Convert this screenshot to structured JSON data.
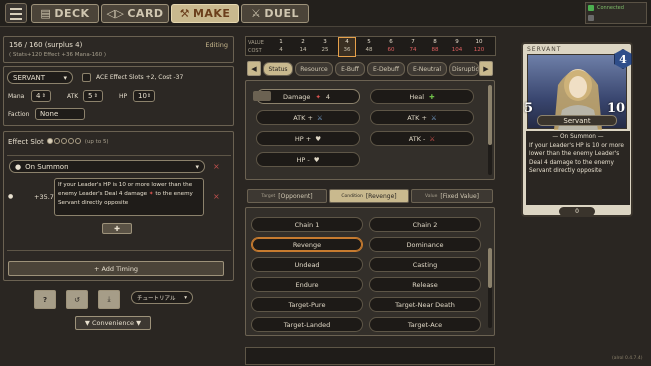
{
  "nav": {
    "tabs": [
      {
        "label": "DECK",
        "icon": "deck-icon"
      },
      {
        "label": "CARD",
        "icon": "card-icon"
      },
      {
        "label": "MAKE",
        "icon": "hammer-icon"
      },
      {
        "label": "DUEL",
        "icon": "swords-icon"
      }
    ]
  },
  "status": {
    "connected": "Connected"
  },
  "cost_header": {
    "summary": "156 / 160 (surplus 4)",
    "mode": "Editing",
    "stats": "( Stats+120  Effect +36  Mana-160 )"
  },
  "value_table": {
    "value_label": "VALUE",
    "cost_label": "COST",
    "values": [
      "1",
      "2",
      "3",
      "4",
      "5",
      "6",
      "7",
      "8",
      "9",
      "10"
    ],
    "costs": [
      "4",
      "14",
      "25",
      "36",
      "48",
      "60",
      "74",
      "88",
      "104",
      "120"
    ],
    "selected_index": 3
  },
  "card_form": {
    "type": "SERVANT",
    "ace_label": "ACE Effect Slots +2, Cost -37",
    "mana_label": "Mana",
    "mana": "4",
    "atk_label": "ATK",
    "atk": "5",
    "hp_label": "HP",
    "hp": "10",
    "faction_label": "Faction",
    "faction": "None"
  },
  "effect_slot": {
    "label": "Effect Slot",
    "filled": 1,
    "total": 5,
    "note": "(up to 5)",
    "timing": "On Summon",
    "cost_delta": "+35.7",
    "effect_text": "If your Leader's HP is 10 or more lower than the enemy Leader's Deal 4 damage",
    "effect_text2": "to the enemy Servant directly opposite",
    "add_timing": "+ Add Timing"
  },
  "bottom_tools": {
    "tutorial": "チュートリアル",
    "convenience": "▼ Convenience ▼"
  },
  "filter_tabs": [
    "Status",
    "Resource",
    "E-Buff",
    "E-Debuff",
    "E-Neutral",
    "Disruptio"
  ],
  "status_actions": [
    {
      "label": "Damage",
      "value": "4",
      "active": true
    },
    {
      "label": "Heal"
    },
    {
      "label": "ATK +"
    },
    {
      "label": "ATK +"
    },
    {
      "label": "ATK -"
    },
    {
      "label": "HP +"
    },
    {
      "label": "ATK -"
    },
    {
      "label": "HP -"
    }
  ],
  "target_tabs": {
    "target": {
      "prefix": "Target",
      "value": "[Opponent]"
    },
    "condition": {
      "prefix": "Condition",
      "value": "[Revenge]"
    },
    "value": {
      "prefix": "Value",
      "value": "[Fixed Value]"
    }
  },
  "conditions": [
    [
      "Chain 1",
      "Chain 2"
    ],
    [
      "Revenge",
      "Dominance"
    ],
    [
      "Undead",
      "Casting"
    ],
    [
      "Endure",
      "Release"
    ],
    [
      "Target-Pure",
      "Target-Near Death"
    ],
    [
      "Target-Landed",
      "Target-Ace"
    ]
  ],
  "card": {
    "type": "SERVANT",
    "mana": "4",
    "atk": "5",
    "hp": "10",
    "name": "Servant",
    "effect_header": "— On Summon —",
    "effect": "If your Leader's HP is 10 or more lower than the enemy Leader's Deal 4 damage to the enemy Servant directly opposite",
    "bottom": "0"
  },
  "version": "(alrol 0.4.7.4)"
}
